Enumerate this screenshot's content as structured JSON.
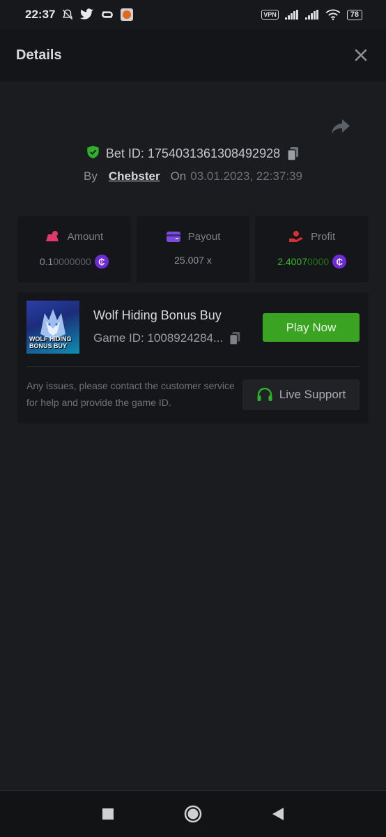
{
  "status_bar": {
    "time": "22:37",
    "left_icons": [
      "bell-off-icon",
      "twitter-icon",
      "app-icon",
      "app-badge-icon"
    ],
    "vpn_label": "VPN",
    "battery": "78"
  },
  "header": {
    "title": "Details"
  },
  "bet": {
    "id_label": "Bet ID: 1754031361308492928",
    "by_label": "By",
    "user": "Chebster",
    "on_label": "On",
    "datetime": "03.01.2023, 22:37:39"
  },
  "stats": {
    "amount": {
      "label": "Amount",
      "value_main": "0.1",
      "value_dim": "0000000"
    },
    "payout": {
      "label": "Payout",
      "value": "25.007 x"
    },
    "profit": {
      "label": "Profit",
      "value_main": "2.4007",
      "value_dim": "0000"
    },
    "coin_symbol": "₵"
  },
  "game": {
    "thumb_text_line1": "WOLF HIDING",
    "thumb_text_line2": "BONUS BUY ......",
    "name": "Wolf Hiding Bonus Buy",
    "id_label": "Game ID: 1008924284...",
    "play_label": "Play Now",
    "help_text": "Any issues, please contact the customer service for help and provide the game ID.",
    "support_label": "Live Support"
  },
  "colors": {
    "accent_green": "#3aa422",
    "coin_purple": "#6f2bd4",
    "amount_icon": "#e0386a",
    "payout_icon": "#7c4ce0",
    "profit_icon": "#d83030",
    "shield_green": "#2fb02a"
  }
}
